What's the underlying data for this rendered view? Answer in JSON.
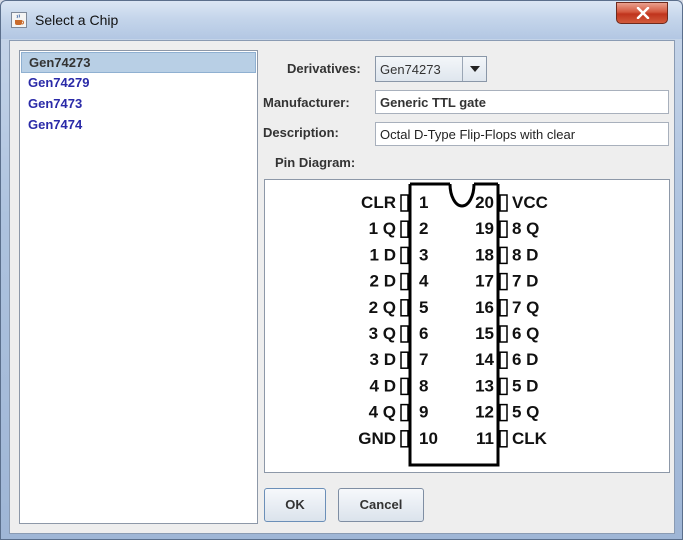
{
  "window": {
    "title": "Select a Chip"
  },
  "chips": [
    "Gen74273",
    "Gen74279",
    "Gen7473",
    "Gen7474"
  ],
  "selected_chip_index": 0,
  "form": {
    "derivatives_label": "Derivatives:",
    "derivatives_value": "Gen74273",
    "manufacturer_label": "Manufacturer:",
    "manufacturer_value": "Generic TTL gate",
    "description_label": "Description:",
    "description_value": "Octal D-Type Flip-Flops with clear",
    "pin_diagram_label": "Pin Diagram:"
  },
  "pins_left": [
    {
      "num": "1",
      "name": "CLR"
    },
    {
      "num": "2",
      "name": "1 Q"
    },
    {
      "num": "3",
      "name": "1 D"
    },
    {
      "num": "4",
      "name": "2 D"
    },
    {
      "num": "5",
      "name": "2 Q"
    },
    {
      "num": "6",
      "name": "3 Q"
    },
    {
      "num": "7",
      "name": "3 D"
    },
    {
      "num": "8",
      "name": "4 D"
    },
    {
      "num": "9",
      "name": "4 Q"
    },
    {
      "num": "10",
      "name": "GND"
    }
  ],
  "pins_right": [
    {
      "num": "20",
      "name": "VCC"
    },
    {
      "num": "19",
      "name": "8 Q"
    },
    {
      "num": "18",
      "name": "8 D"
    },
    {
      "num": "17",
      "name": "7 D"
    },
    {
      "num": "16",
      "name": "7 Q"
    },
    {
      "num": "15",
      "name": "6 Q"
    },
    {
      "num": "14",
      "name": "6 D"
    },
    {
      "num": "13",
      "name": "5 D"
    },
    {
      "num": "12",
      "name": "5 Q"
    },
    {
      "num": "11",
      "name": "CLK"
    }
  ],
  "buttons": {
    "ok": "OK",
    "cancel": "Cancel"
  },
  "icons": {
    "app": "java-cup-icon",
    "close": "close-icon",
    "dropdown": "dropdown-arrow-icon"
  },
  "colors": {
    "selection": "#b8cfe5",
    "chip_text": "#2a2aa8",
    "close_button": "#c8432b"
  }
}
